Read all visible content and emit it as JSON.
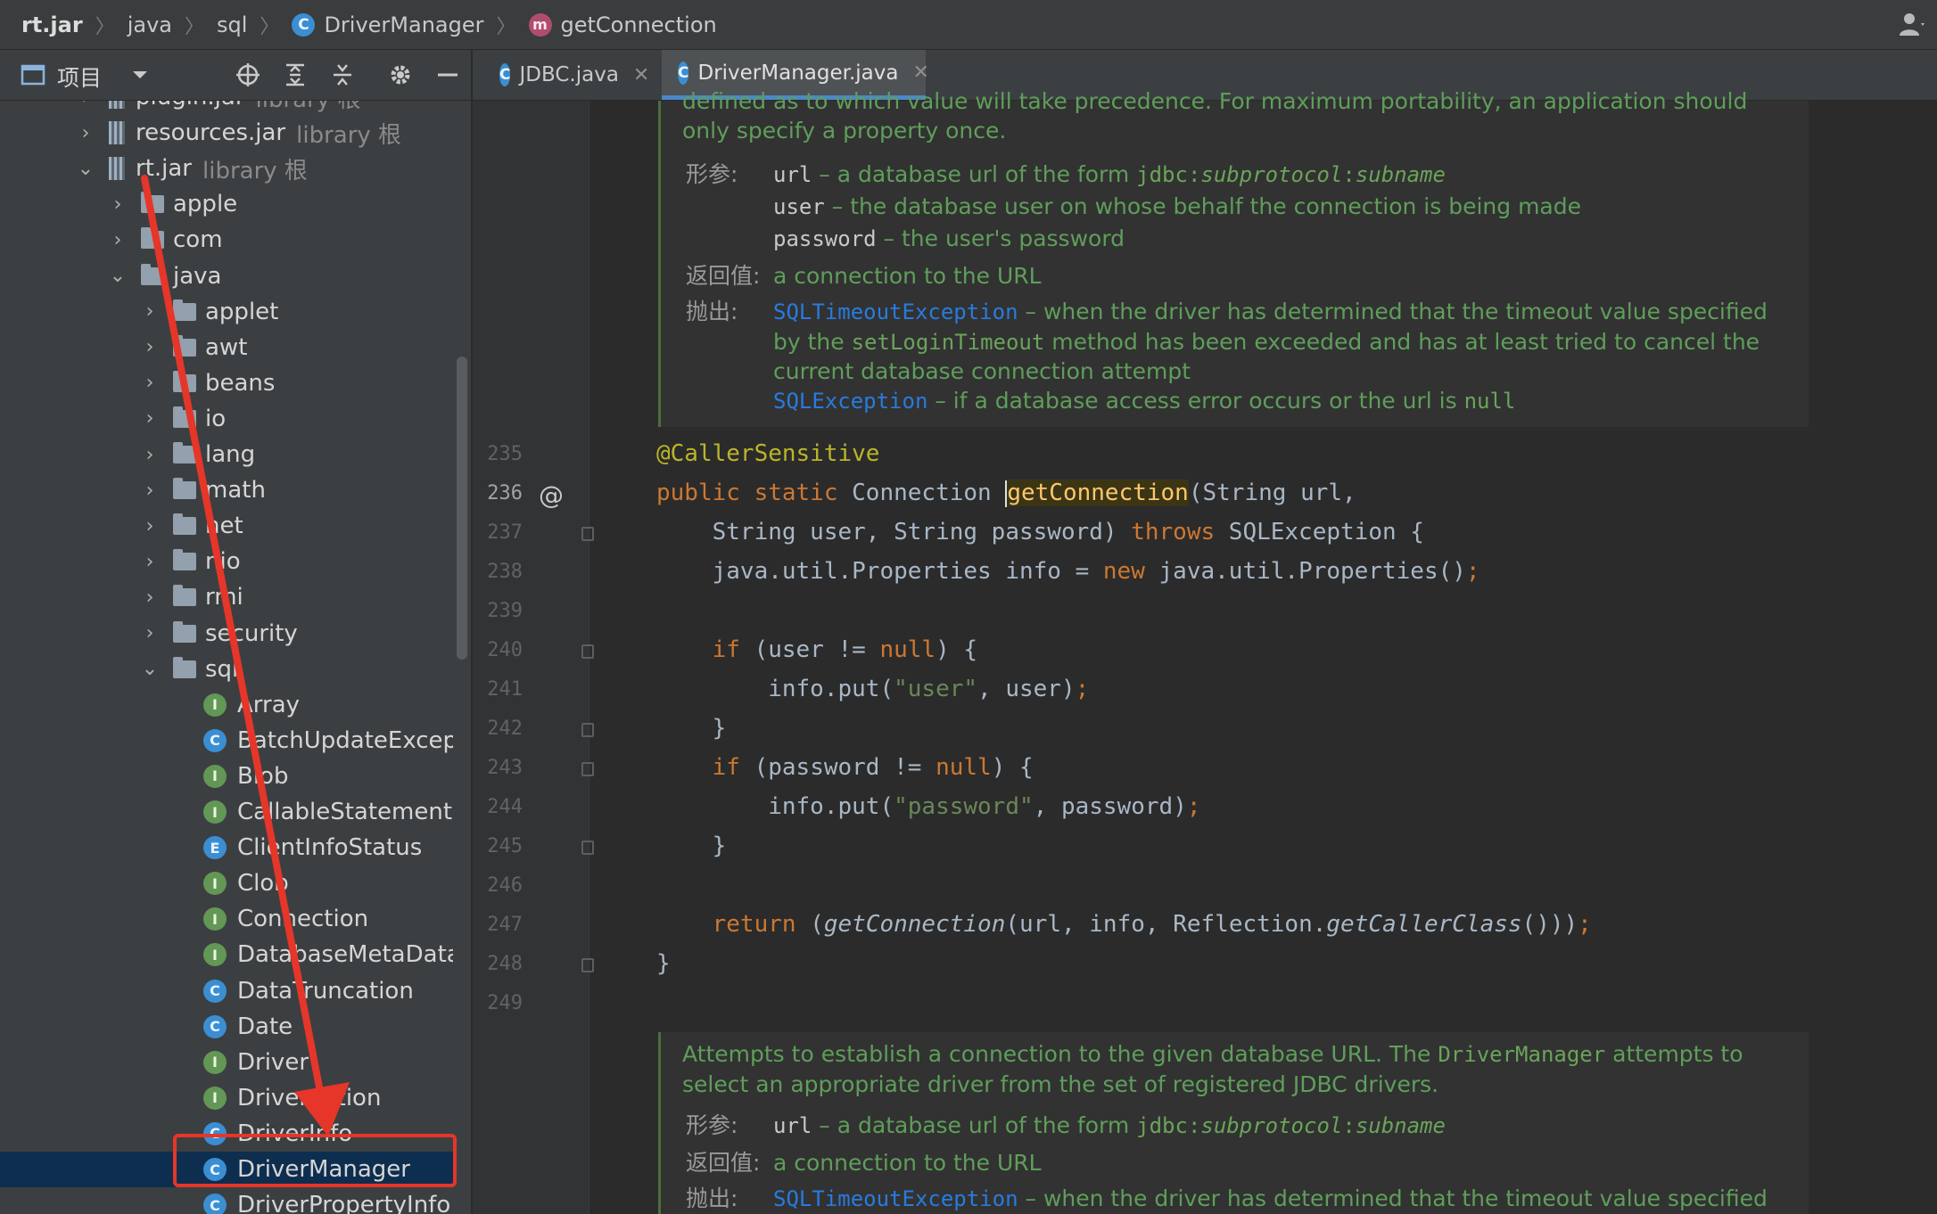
{
  "breadcrumb": {
    "items": [
      "rt.jar",
      "java",
      "sql",
      "DriverManager",
      "getConnection"
    ]
  },
  "project_panel": {
    "title": "项目",
    "tree": [
      {
        "label": "plugin.jar",
        "suffix": "library 根",
        "kind": "jar",
        "expanded": false
      },
      {
        "label": "resources.jar",
        "suffix": "library 根",
        "kind": "jar",
        "expanded": false
      },
      {
        "label": "rt.jar",
        "suffix": "library 根",
        "kind": "jar",
        "expanded": true
      },
      {
        "label": "apple",
        "kind": "package",
        "expanded": false
      },
      {
        "label": "com",
        "kind": "package",
        "expanded": false
      },
      {
        "label": "java",
        "kind": "package",
        "expanded": true
      },
      {
        "label": "applet",
        "kind": "package",
        "expanded": false
      },
      {
        "label": "awt",
        "kind": "package",
        "expanded": false
      },
      {
        "label": "beans",
        "kind": "package",
        "expanded": false
      },
      {
        "label": "io",
        "kind": "package",
        "expanded": false
      },
      {
        "label": "lang",
        "kind": "package",
        "expanded": false
      },
      {
        "label": "math",
        "kind": "package",
        "expanded": false
      },
      {
        "label": "net",
        "kind": "package",
        "expanded": false
      },
      {
        "label": "nio",
        "kind": "package",
        "expanded": false
      },
      {
        "label": "rmi",
        "kind": "package",
        "expanded": false
      },
      {
        "label": "security",
        "kind": "package",
        "expanded": false
      },
      {
        "label": "sql",
        "kind": "package",
        "expanded": true
      },
      {
        "label": "Array",
        "kind": "I"
      },
      {
        "label": "BatchUpdateException",
        "kind": "C"
      },
      {
        "label": "Blob",
        "kind": "I"
      },
      {
        "label": "CallableStatement",
        "kind": "I"
      },
      {
        "label": "ClientInfoStatus",
        "kind": "E"
      },
      {
        "label": "Clob",
        "kind": "I"
      },
      {
        "label": "Connection",
        "kind": "I"
      },
      {
        "label": "DatabaseMetaData",
        "kind": "I"
      },
      {
        "label": "DataTruncation",
        "kind": "C"
      },
      {
        "label": "Date",
        "kind": "C"
      },
      {
        "label": "Driver",
        "kind": "I"
      },
      {
        "label": "DriverAction",
        "kind": "I"
      },
      {
        "label": "DriverInfo",
        "kind": "C"
      },
      {
        "label": "DriverManager",
        "kind": "C",
        "selected": true
      },
      {
        "label": "DriverPropertyInfo",
        "kind": "C"
      }
    ]
  },
  "tabs": [
    {
      "label": "JDBC.java",
      "active": false
    },
    {
      "label": "DriverManager.java",
      "active": true
    }
  ],
  "editor": {
    "doc_top": {
      "line1": "defined as to which value will take precedence. For maximum portability, an application should",
      "line2": "only specify a property once.",
      "params_tag": "形参:",
      "param_url_name": "url",
      "param_url_text": " – a database url of the form ",
      "param_url_code": "jdbc:",
      "param_url_code_it": "subprotocol",
      "param_url_code2": ":",
      "param_url_code_it2": "subname",
      "param_user_name": "user",
      "param_user_text": " – the database user on whose behalf the connection is being made",
      "param_password_name": "password",
      "param_password_text": " – the user's password",
      "returns_tag": "返回值:",
      "returns_text": "a connection to the URL",
      "throws_tag": "抛出:",
      "throws1_link": "SQLTimeoutException",
      "throws1_text": " – when the driver has determined that the timeout value specified",
      "throws1_line2a": "by the ",
      "throws1_line2_code": "setLoginTimeout",
      "throws1_line2b": " method has been exceeded and has at least tried to cancel the",
      "throws1_line3": "current database connection attempt",
      "throws2_link": "SQLException",
      "throws2_text": " – if a database access error occurs or the url is ",
      "throws2_code": "null"
    },
    "line_numbers": [
      "235",
      "236",
      "237",
      "238",
      "239",
      "240",
      "241",
      "242",
      "243",
      "244",
      "245",
      "246",
      "247",
      "248",
      "249"
    ],
    "code": {
      "l235": "@CallerSensitive",
      "l236_kw": "public static ",
      "l236_type": "Connection ",
      "l236_fn": "getConnection",
      "l236_rest": "(String url,",
      "l237_a": "    String user, String password) ",
      "l237_kw": "throws",
      "l237_b": " SQLException {",
      "l238_a": "    java.util.Properties info = ",
      "l238_kw": "new",
      "l238_b": " java.util.Properties()",
      "l238_semi": ";",
      "l240_kw": "    if",
      "l240_a": " (user != ",
      "l240_null": "null",
      "l240_b": ") {",
      "l241_a": "        info.put(",
      "l241_str": "\"user\"",
      "l241_b": ", user)",
      "l241_semi": ";",
      "l242": "    }",
      "l243_kw": "    if",
      "l243_a": " (password != ",
      "l243_null": "null",
      "l243_b": ") {",
      "l244_a": "        info.put(",
      "l244_str": "\"password\"",
      "l244_b": ", password)",
      "l244_semi": ";",
      "l245": "    }",
      "l247_kw": "    return",
      "l247_a": " (",
      "l247_it": "getConnection",
      "l247_b": "(url, info, Reflection.",
      "l247_it2": "getCallerClass",
      "l247_c": "()))",
      "l247_semi": ";",
      "l248": "}"
    },
    "doc_bottom": {
      "line1a": "Attempts to establish a connection to the given database URL. The ",
      "line1_code": "DriverManager",
      "line1b": " attempts to",
      "line2": "select an appropriate driver from the set of registered JDBC drivers.",
      "params_tag": "形参:",
      "param_url_name": "url",
      "param_url_text": " – a database url of the form ",
      "param_url_code": "jdbc:",
      "param_url_code_it": "subprotocol",
      "param_url_code2": ":",
      "param_url_code_it2": "subname",
      "returns_tag": "返回值:",
      "returns_text": "a connection to the URL",
      "throws_tag": "抛出:",
      "throws1_link": "SQLTimeoutException",
      "throws1_text": " – when the driver has determined that the timeout value specified"
    }
  },
  "colors": {
    "accent_annotation": "#e53629",
    "selection": "#0d2e4f",
    "doc_text": "#5f9e5a",
    "keyword": "#cc7832"
  },
  "icons": [
    "class-icon",
    "method-icon",
    "project-view-icon",
    "dropdown-icon",
    "locate-icon",
    "expand-all-icon",
    "collapse-all-icon",
    "gear-icon",
    "minimize-icon",
    "user-icon",
    "java-file-icon",
    "close-icon"
  ]
}
